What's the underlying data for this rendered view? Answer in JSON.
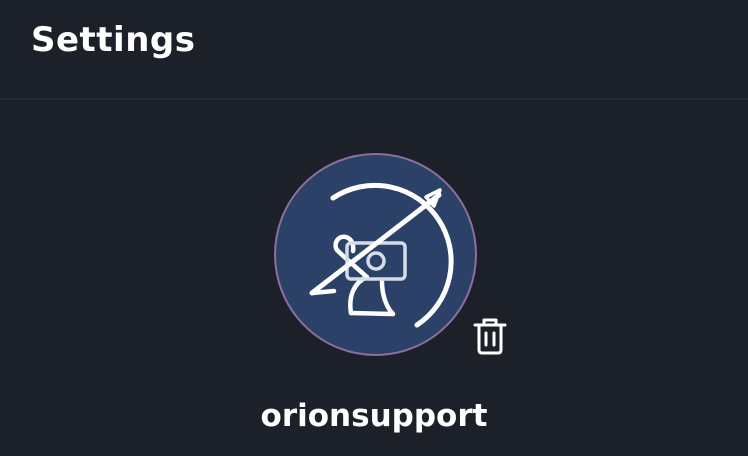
{
  "header": {
    "title": "Settings"
  },
  "profile": {
    "username": "orionsupport",
    "avatar_icon": "no-camera-antelope-icon",
    "delete_icon": "trash-icon"
  },
  "colors": {
    "background": "#1c2028",
    "avatar_background": "#2b4168",
    "avatar_border": "#8c6f9c",
    "text": "#ffffff"
  }
}
